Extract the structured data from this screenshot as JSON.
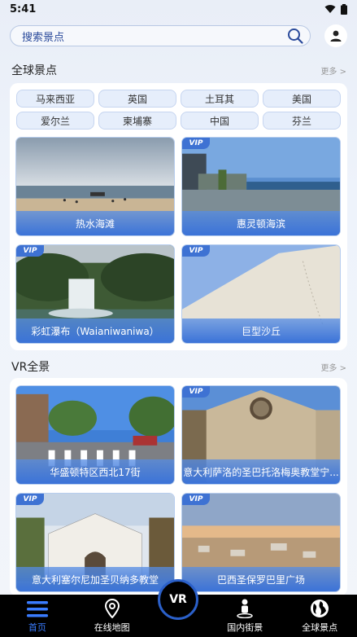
{
  "status": {
    "time": "5:41"
  },
  "search": {
    "placeholder": "搜索景点"
  },
  "global": {
    "title": "全球景点",
    "more": "更多 >",
    "chips": [
      "马来西亚",
      "英国",
      "土耳其",
      "美国",
      "爱尔兰",
      "柬埔寨",
      "中国",
      "芬兰"
    ],
    "cards": [
      {
        "label": "热水海滩",
        "vip": false
      },
      {
        "label": "惠灵顿海滨",
        "vip": true
      },
      {
        "label": "彩虹瀑布（Waianiwaniwa）",
        "vip": true
      },
      {
        "label": "巨型沙丘",
        "vip": true
      }
    ]
  },
  "vr": {
    "title": "VR全景",
    "more": "更多 >",
    "cards": [
      {
        "label": "华盛顿特区西北17街",
        "vip": false
      },
      {
        "label": "意大利萨洛的圣巴托洛梅奥教堂宁...",
        "vip": true
      },
      {
        "label": "意大利塞尔尼加圣贝纳多教堂",
        "vip": true
      },
      {
        "label": "巴西圣保罗巴里广场",
        "vip": true
      }
    ]
  },
  "vip_badge": "VIP",
  "nav": {
    "home": "首页",
    "map": "在线地图",
    "vr": "VR",
    "street": "国内街景",
    "global": "全球景点"
  },
  "colors": {
    "accent": "#3b73d8",
    "active_nav": "#3a7cff"
  }
}
